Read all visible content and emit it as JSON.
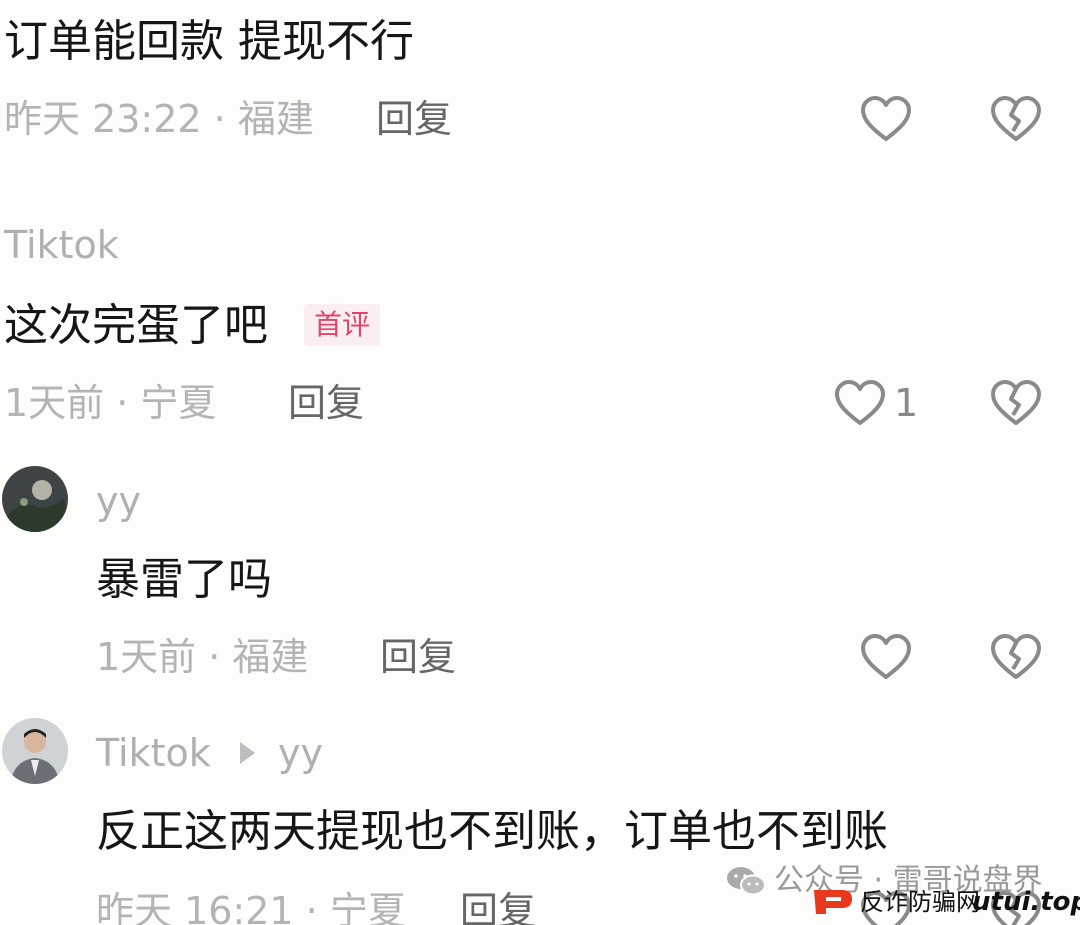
{
  "comments": [
    {
      "text": "订单能回款 提现不行",
      "meta": "昨天 23:22 · 福建",
      "reply": "回复"
    },
    {
      "username": "Tiktok",
      "text": "这次完蛋了吧",
      "badge": "首评",
      "meta": "1天前 · 宁夏",
      "reply": "回复",
      "like_count": "1"
    },
    {
      "username": "yy",
      "text": "暴雷了吗",
      "meta": "1天前 · 福建",
      "reply": "回复"
    },
    {
      "username": "Tiktok",
      "reply_to": "yy",
      "text": "反正这两天提现也不到账，订单也不到账",
      "meta": "昨天 16:21 · 宁夏",
      "reply": "回复"
    }
  ],
  "watermark": {
    "account": "公众号 · 雷哥说盘界",
    "site_label": "反诈防骗网",
    "site_domain": "utui.top"
  },
  "colors": {
    "like_icon": "#8a8a8a",
    "badge_text": "#e0446a",
    "badge_bg": "#fbeef0",
    "watermark_logo": "#e8391d"
  },
  "icons": {
    "like": "heart-outline-icon",
    "dislike": "broken-heart-icon",
    "expand": "play-arrow-icon"
  }
}
